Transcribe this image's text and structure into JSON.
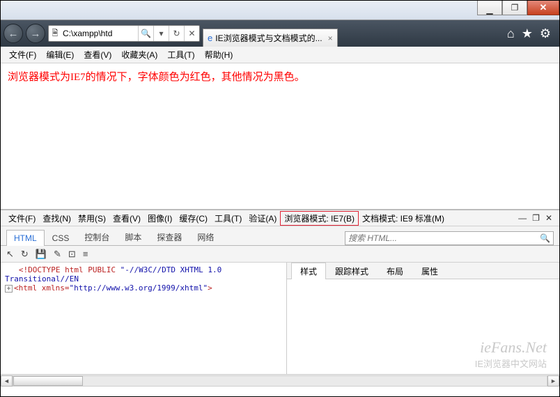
{
  "window": {
    "minimize_glyph": "▁",
    "maximize_glyph": "❐",
    "close_glyph": "✕"
  },
  "nav": {
    "back_glyph": "←",
    "forward_glyph": "→",
    "page_icon": "🗎",
    "address": "C:\\xampp\\htd",
    "search_glyph": "🔍",
    "dropdown_glyph": "▾",
    "refresh_glyph": "↻",
    "stop_glyph": "✕",
    "tab": {
      "ie_icon": "e",
      "title": "IE浏览器模式与文档模式的...",
      "close": "×"
    },
    "home_icon": "⌂",
    "star_icon": "★",
    "gear_icon": "⚙"
  },
  "menubar": {
    "items": [
      "文件(F)",
      "编辑(E)",
      "查看(V)",
      "收藏夹(A)",
      "工具(T)",
      "帮助(H)"
    ]
  },
  "page_content": "浏览器模式为IE7的情况下，字体颜色为红色，其他情况为黑色。",
  "devtools": {
    "menu": {
      "items": [
        "文件(F)",
        "查找(N)",
        "禁用(S)",
        "查看(V)",
        "图像(I)",
        "缓存(C)",
        "工具(T)",
        "验证(A)"
      ],
      "browser_mode": "浏览器模式: IE7(B)",
      "doc_mode": "文档模式: IE9 标准(M)",
      "minimize": "—",
      "restore": "❐",
      "close": "✕"
    },
    "tabs": [
      "HTML",
      "CSS",
      "控制台",
      "脚本",
      "探查器",
      "网络"
    ],
    "active_tab": "HTML",
    "search_placeholder": "搜索 HTML...",
    "search_icon": "🔍",
    "toolbar_icons": [
      "↖",
      "↻",
      "💾",
      "✎",
      "⊡",
      "≡"
    ],
    "source": {
      "doctype_keyword": "<!DOCTYPE html PUBLIC ",
      "doctype_str": "\"-//W3C//DTD XHTML 1.0 Transitional//EN",
      "line2_pre": "<html xmlns=",
      "line2_val": "\"http://www.w3.org/1999/xhtml\"",
      "line2_post": ">"
    },
    "right_tabs": [
      "样式",
      "跟踪样式",
      "布局",
      "属性"
    ],
    "right_active": "样式"
  },
  "watermark": {
    "big": "ieFans.Net",
    "small": "IE浏览器中文网站"
  }
}
